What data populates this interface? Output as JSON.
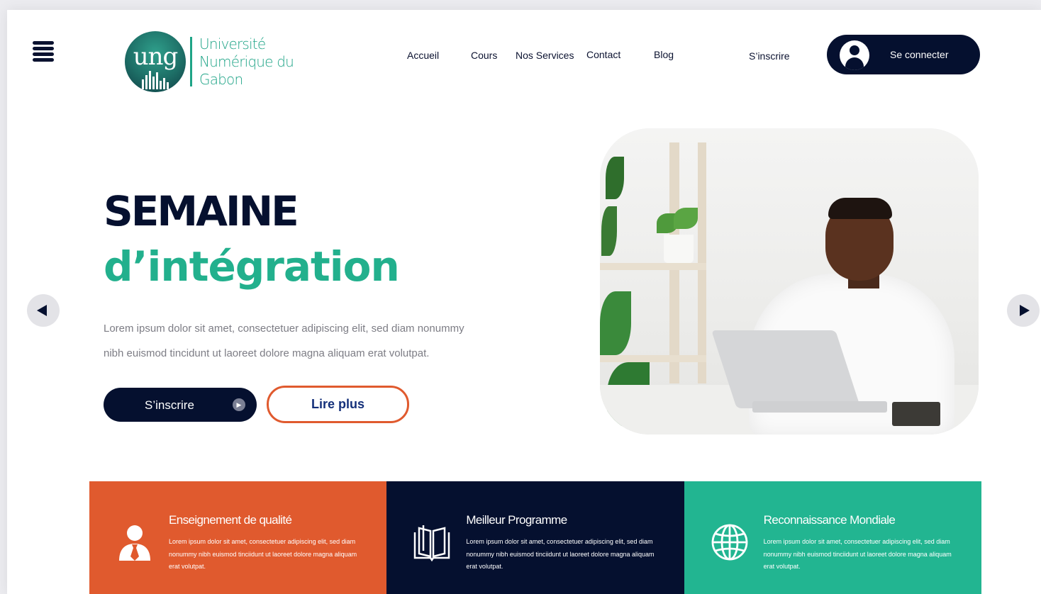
{
  "header": {
    "logo": {
      "monogram": "ung",
      "line1": "Université",
      "line2": "Numérique du",
      "line3": "Gabon"
    },
    "nav": [
      "Accueil",
      "Cours",
      "Nos Services",
      "Contact",
      "Blog"
    ],
    "register_link": "S’inscrire",
    "login_button": "Se connecter"
  },
  "hero": {
    "title_line1": "SEMAINE",
    "title_line2": "d’intégration",
    "description_line1": "Lorem ipsum dolor sit amet, consectetuer adipiscing elit, sed diam nonummy",
    "description_line2": "nibh euismod tincidunt ut laoreet dolore magna aliquam erat volutpat.",
    "register_button": "S’inscrire",
    "read_more_button": "Lire plus"
  },
  "features": [
    {
      "title": "Enseignement de qualité",
      "desc": "Lorem ipsum dolor sit amet, consectetuer adipiscing elit, sed diam nonummy nibh euismod tinciidunt ut laoreet dolore magna aliquam erat volutpat.",
      "icon": "person-with-tie-icon",
      "color": "#e05a2e"
    },
    {
      "title": "Meilleur Programme",
      "desc": "Lorem ipsum dolor sit amet, consectetuer adipiscing elit, sed diam nonummy nibh euismod tinciidunt ut laoreet dolore magna aliquam erat volutpat.",
      "icon": "open-book-icon",
      "color": "#05102f"
    },
    {
      "title": "Reconnaissance Mondiale",
      "desc": "Lorem ipsum dolor sit amet, consectetuer adipiscing elit, sed diam nonummy nibh euismod tinciidunt ut laoreet dolore magna aliquam erat volutpat.",
      "icon": "globe-icon",
      "color": "#22b591"
    }
  ],
  "colors": {
    "navy": "#05102f",
    "green": "#22b08d",
    "orange": "#e05a2e",
    "teal": "#22b591"
  }
}
